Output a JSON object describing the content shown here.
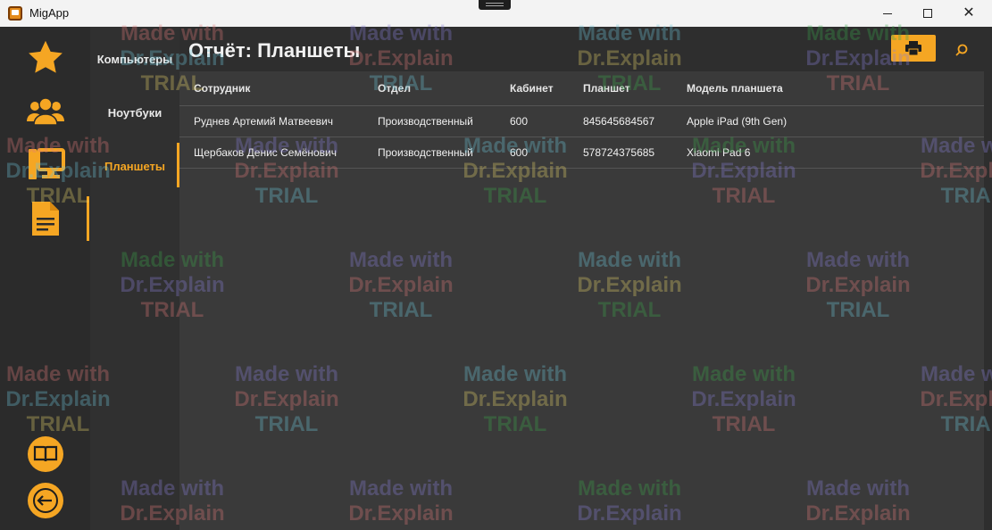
{
  "window": {
    "title": "MigApp",
    "colors": {
      "accent": "#f5a623",
      "rail_bg": "#2b2b2b",
      "panel_bg": "#303030",
      "table_bg": "#3a3a3a"
    }
  },
  "rail": {
    "items": [
      {
        "icon": "star-icon",
        "active": false
      },
      {
        "icon": "users-icon",
        "active": false
      },
      {
        "icon": "computer-icon",
        "active": false
      },
      {
        "icon": "report-document-icon",
        "active": true
      }
    ],
    "bottom": [
      {
        "icon": "book-icon"
      },
      {
        "icon": "logout-icon"
      }
    ]
  },
  "nav": {
    "items": [
      {
        "label": "Компьютеры",
        "active": false
      },
      {
        "label": "Ноутбуки",
        "active": false
      },
      {
        "label": "Планшеты",
        "active": true
      }
    ]
  },
  "main": {
    "title": "Отчёт: Планшеты",
    "print_icon": "printer-icon",
    "search_icon": "search-icon"
  },
  "table": {
    "columns": [
      "Сотрудник",
      "Отдел",
      "Кабинет",
      "Планшет",
      "Модель планшета"
    ],
    "rows": [
      [
        "Руднев Артемий Матвеевич",
        "Производственный",
        "600",
        "845645684567",
        "Apple iPad (9th Gen)"
      ],
      [
        "Щербаков Денис Семёнович",
        "Производственный",
        "600",
        "578724375685",
        "Xiaomi Pad 6"
      ]
    ]
  },
  "watermark": {
    "line1": "Made with",
    "line2": "Dr.Explain",
    "line3": "TRIAL"
  }
}
